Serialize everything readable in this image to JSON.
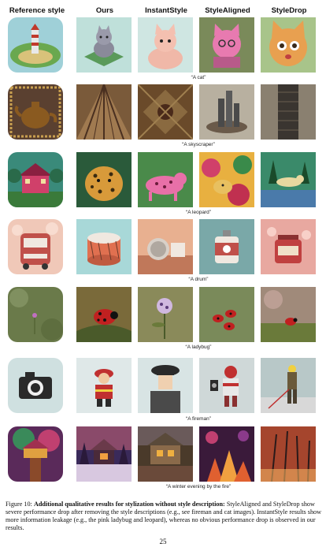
{
  "headers": [
    "Reference style",
    "Ours",
    "InstantStyle",
    "StyleAligned",
    "StyleDrop"
  ],
  "rows": [
    {
      "caption": "“A cat”",
      "subject": "cat"
    },
    {
      "caption": "“A skyscraper”",
      "subject": "skyscraper"
    },
    {
      "caption": "“A leopard”",
      "subject": "leopard"
    },
    {
      "caption": "“A drum”",
      "subject": "drum"
    },
    {
      "caption": "“A ladybug”",
      "subject": "ladybug"
    },
    {
      "caption": "“A fireman”",
      "subject": "fireman"
    },
    {
      "caption": "“A winter evening by the fire”",
      "subject": "winter-evening"
    }
  ],
  "figure_caption": {
    "label": "Figure 10:",
    "bold": "Additional qualitative results for stylization without style description:",
    "text": "StyleAligned and StyleDrop show severe performance drop after removing the style descriptions (e.g., see fireman and cat images). InstantStyle results show more information leakage (e.g., the pink ladybug and leopard), whereas no obvious performance drop is observed in our results."
  },
  "page_number": "25",
  "colors": {
    "cat_bg": "#bfe0da",
    "skyscraper_bg": "#7a5a3a",
    "leopard_bg": "#3a8a7a",
    "drum_bg": "#f0c8b8",
    "ladybug_bg": "#6a7a4a",
    "fireman_bg": "#dfe8e8",
    "winter_bg": "#5a2a5a"
  }
}
